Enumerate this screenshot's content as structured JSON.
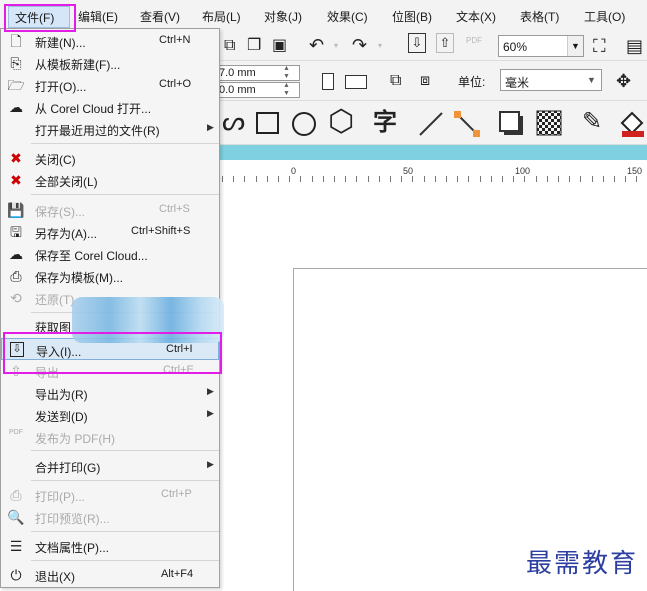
{
  "menubar": {
    "items": [
      "文件(F)",
      "编辑(E)",
      "查看(V)",
      "布局(L)",
      "对象(J)",
      "效果(C)",
      "位图(B)",
      "文本(X)",
      "表格(T)",
      "工具(O)"
    ]
  },
  "toolbar1": {
    "zoom": "60%",
    "pdf_label": "PDF"
  },
  "toolbar2": {
    "width_value": "7.0 mm",
    "height_value": "0.0 mm",
    "unit_label": "单位:",
    "unit_value": "毫米"
  },
  "toolbar3": {
    "text_tool_glyph": "字"
  },
  "ruler": {
    "labels": [
      "0",
      "50",
      "100",
      "150"
    ]
  },
  "file_menu": {
    "items": [
      {
        "label": "新建(N)...",
        "shortcut": "Ctrl+N",
        "icon": "new-doc-icon"
      },
      {
        "label": "从模板新建(F)...",
        "shortcut": "",
        "icon": "template-icon"
      },
      {
        "label": "打开(O)...",
        "shortcut": "Ctrl+O",
        "icon": "folder-open-icon"
      },
      {
        "label": "从 Corel Cloud 打开...",
        "shortcut": "",
        "icon": "cloud-download-icon"
      },
      {
        "label": "打开最近用过的文件(R)",
        "shortcut": "",
        "icon": ""
      },
      {
        "label": "关闭(C)",
        "shortcut": "",
        "icon": "close-doc-icon"
      },
      {
        "label": "全部关闭(L)",
        "shortcut": "",
        "icon": "close-all-icon"
      },
      {
        "label": "保存(S)...",
        "shortcut": "Ctrl+S",
        "icon": "save-icon"
      },
      {
        "label": "另存为(A)...",
        "shortcut": "Ctrl+Shift+S",
        "icon": "save-as-icon"
      },
      {
        "label": "保存至 Corel Cloud...",
        "shortcut": "",
        "icon": "cloud-upload-icon"
      },
      {
        "label": "保存为模板(M)...",
        "shortcut": "",
        "icon": "save-template-icon"
      },
      {
        "label": "还原(T)",
        "shortcut": "",
        "icon": "revert-icon"
      },
      {
        "label": "获取图",
        "shortcut": "",
        "icon": ""
      },
      {
        "label": "导入(I)...",
        "shortcut": "Ctrl+I",
        "icon": "import-icon"
      },
      {
        "label": "导出",
        "shortcut": "Ctrl+E",
        "icon": "export-icon"
      },
      {
        "label": "导出为(R)",
        "shortcut": "",
        "icon": ""
      },
      {
        "label": "发送到(D)",
        "shortcut": "",
        "icon": ""
      },
      {
        "label": "发布为 PDF(H)",
        "shortcut": "",
        "icon": "pdf-icon"
      },
      {
        "label": "合并打印(G)",
        "shortcut": "",
        "icon": ""
      },
      {
        "label": "打印(P)...",
        "shortcut": "Ctrl+P",
        "icon": "print-icon"
      },
      {
        "label": "打印预览(R)...",
        "shortcut": "",
        "icon": "print-preview-icon"
      },
      {
        "label": "文档属性(P)...",
        "shortcut": "",
        "icon": "properties-icon"
      },
      {
        "label": "退出(X)",
        "shortcut": "Alt+F4",
        "icon": "power-icon"
      }
    ]
  },
  "watermark": "最需教育"
}
